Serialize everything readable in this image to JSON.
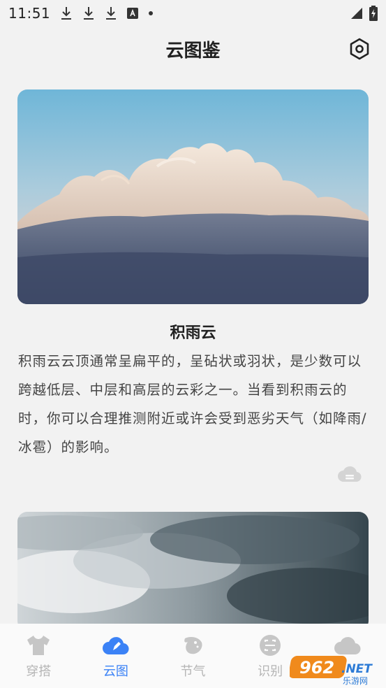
{
  "status_bar": {
    "time": "11:51",
    "icons": [
      "download-icon",
      "download-icon",
      "download-icon",
      "font-a-icon",
      "dot-icon",
      "signal-icon",
      "battery-charging-icon"
    ]
  },
  "header": {
    "title": "云图鉴",
    "settings_icon": "gear-hex-icon"
  },
  "cards": [
    {
      "title": "积雨云",
      "description": "积雨云云顶通常呈扁平的，呈砧状或羽状，是少数可以跨越低层、中层和高层的云彩之一。当看到积雨云的时，你可以合理推测附近或许会受到恶劣天气（如降雨/冰雹）的影响。",
      "badge_icon": "cloud-icon"
    }
  ],
  "tabbar": {
    "tabs": [
      {
        "label": "穿搭",
        "icon": "shirt-icon",
        "active": false
      },
      {
        "label": "云图",
        "icon": "cloud-edit-icon",
        "active": true
      },
      {
        "label": "节气",
        "icon": "leaf-icon",
        "active": false
      },
      {
        "label": "识别",
        "icon": "scan-icon",
        "active": false
      },
      {
        "label": "",
        "icon": "cloud-icon",
        "active": false
      }
    ]
  },
  "watermark": {
    "text": "962.NET",
    "sub": "乐游网"
  },
  "colors": {
    "accent": "#3b82f6",
    "inactive": "#b5b5b5",
    "background": "#f2f2f2"
  }
}
